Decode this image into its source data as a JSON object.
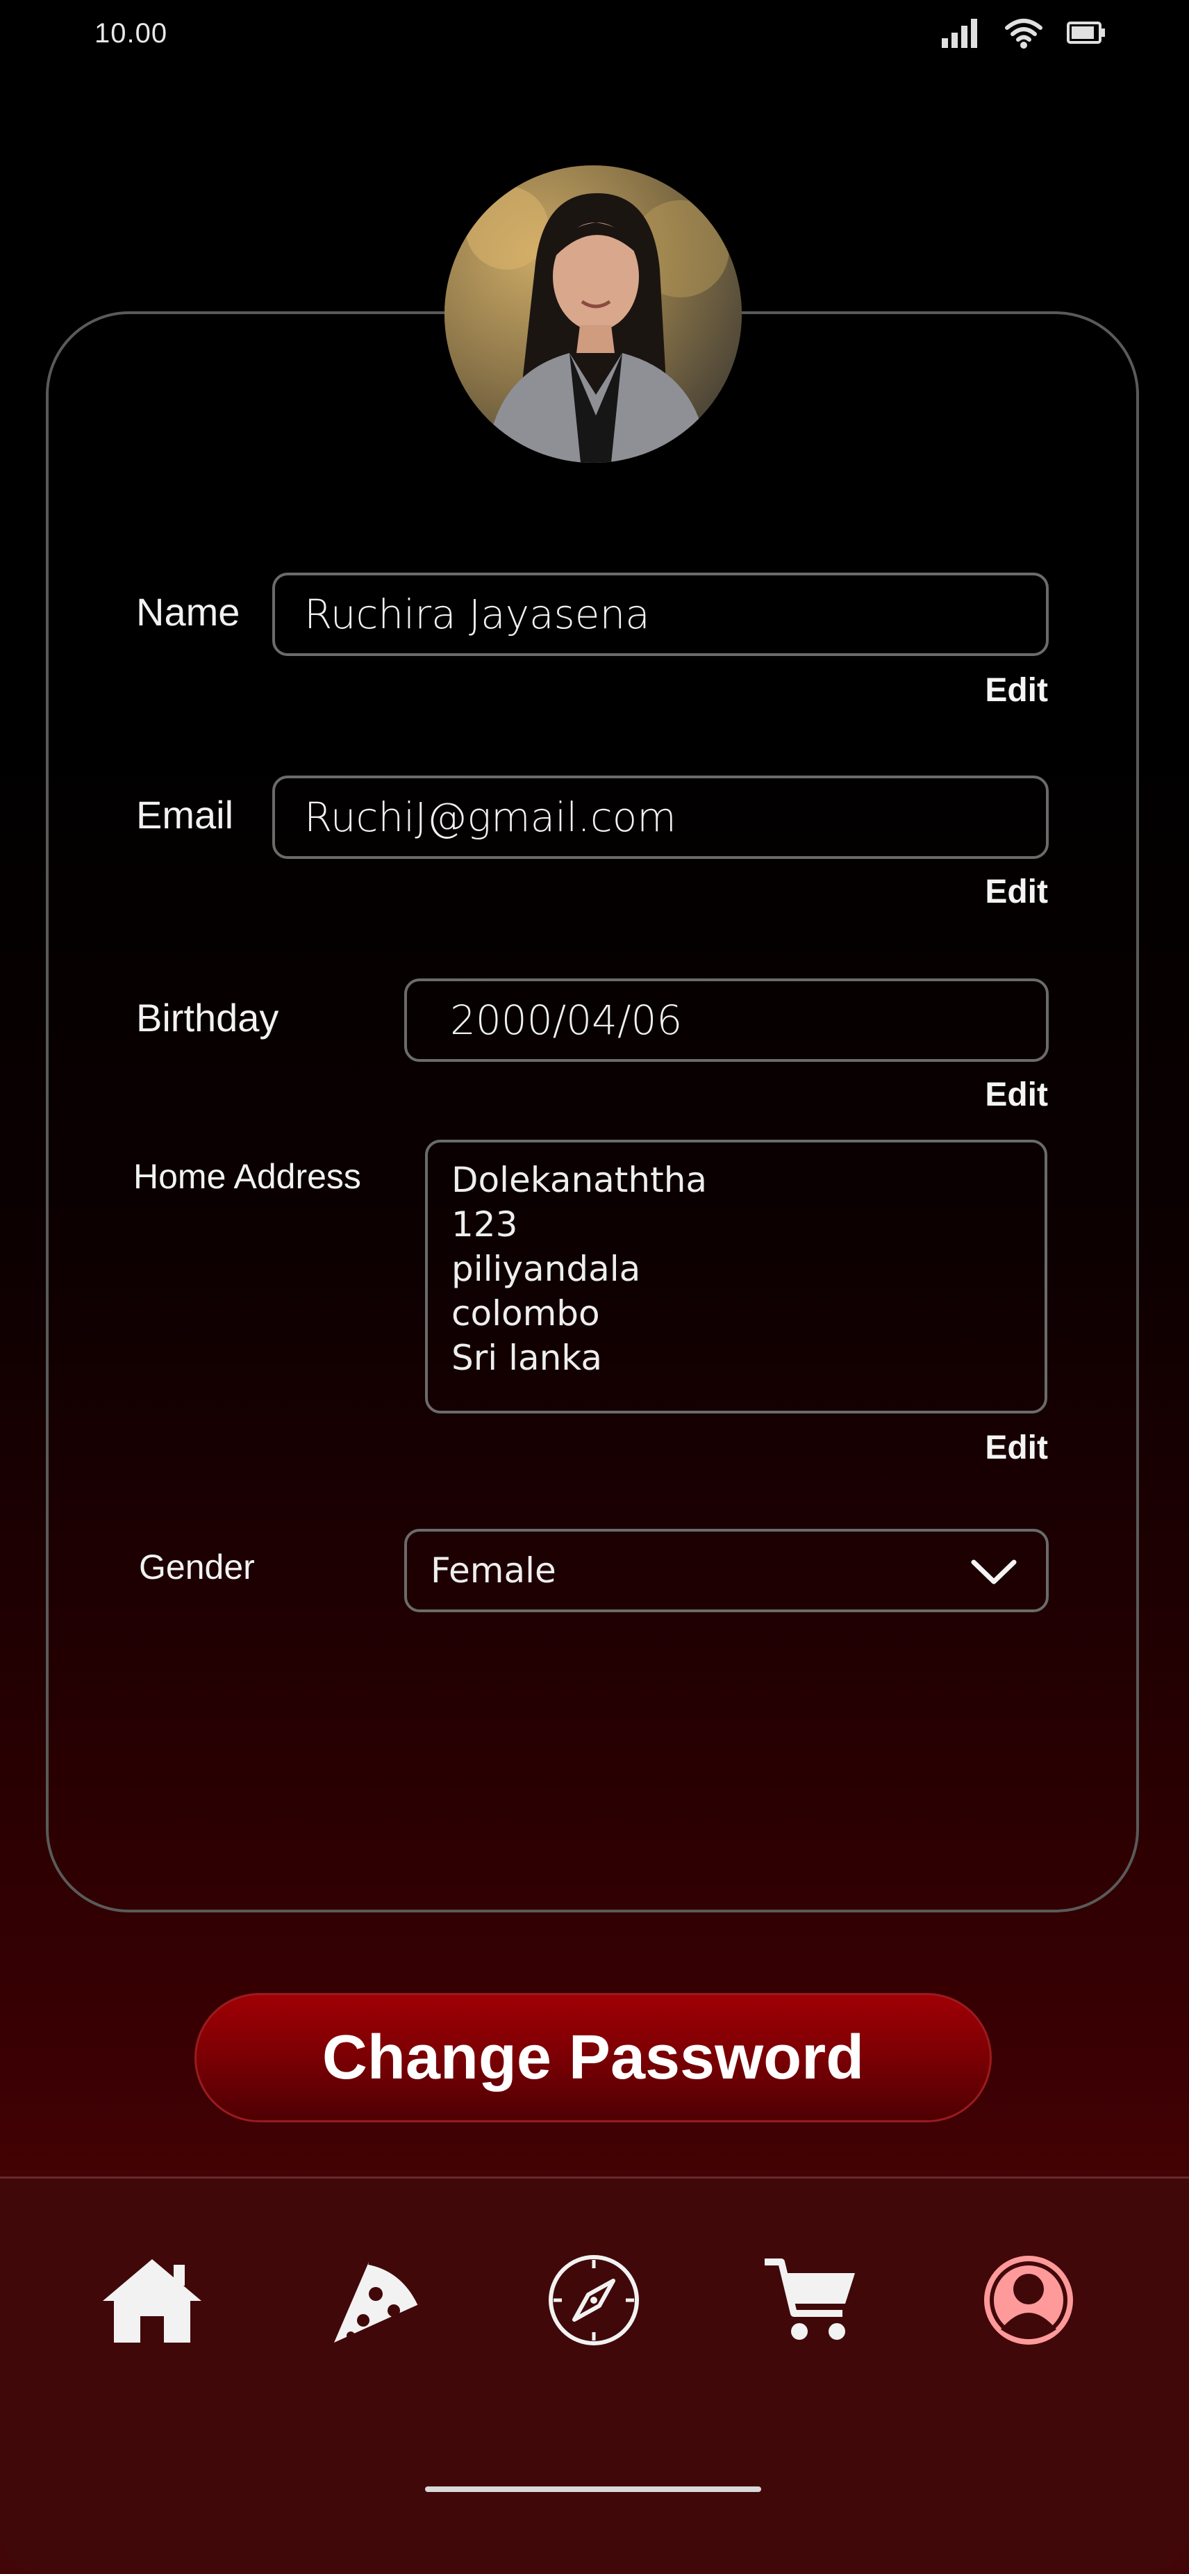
{
  "status_bar": {
    "time": "10.00"
  },
  "profile": {
    "name_label": "Name",
    "name_value": "Ruchira Jayasena",
    "email_label": "Email",
    "email_value": "RuchiJ@gmail.com",
    "birthday_label": "Birthday",
    "birthday_value": "2000/04/06",
    "address_label": "Home Address",
    "address_lines": [
      "Dolekanaththa",
      "123",
      "piliyandala",
      "colombo",
      "Sri lanka"
    ],
    "gender_label": "Gender",
    "gender_value": "Female",
    "edit_label": "Edit"
  },
  "actions": {
    "change_password": "Change Password"
  },
  "nav": {
    "items": [
      {
        "icon": "home-icon"
      },
      {
        "icon": "pizza-icon"
      },
      {
        "icon": "compass-icon"
      },
      {
        "icon": "cart-icon"
      },
      {
        "icon": "profile-icon",
        "active": true
      }
    ],
    "active_color": "#ff9a9a"
  },
  "colors": {
    "accent": "#8b0006",
    "nav_bg": "#41080a"
  }
}
